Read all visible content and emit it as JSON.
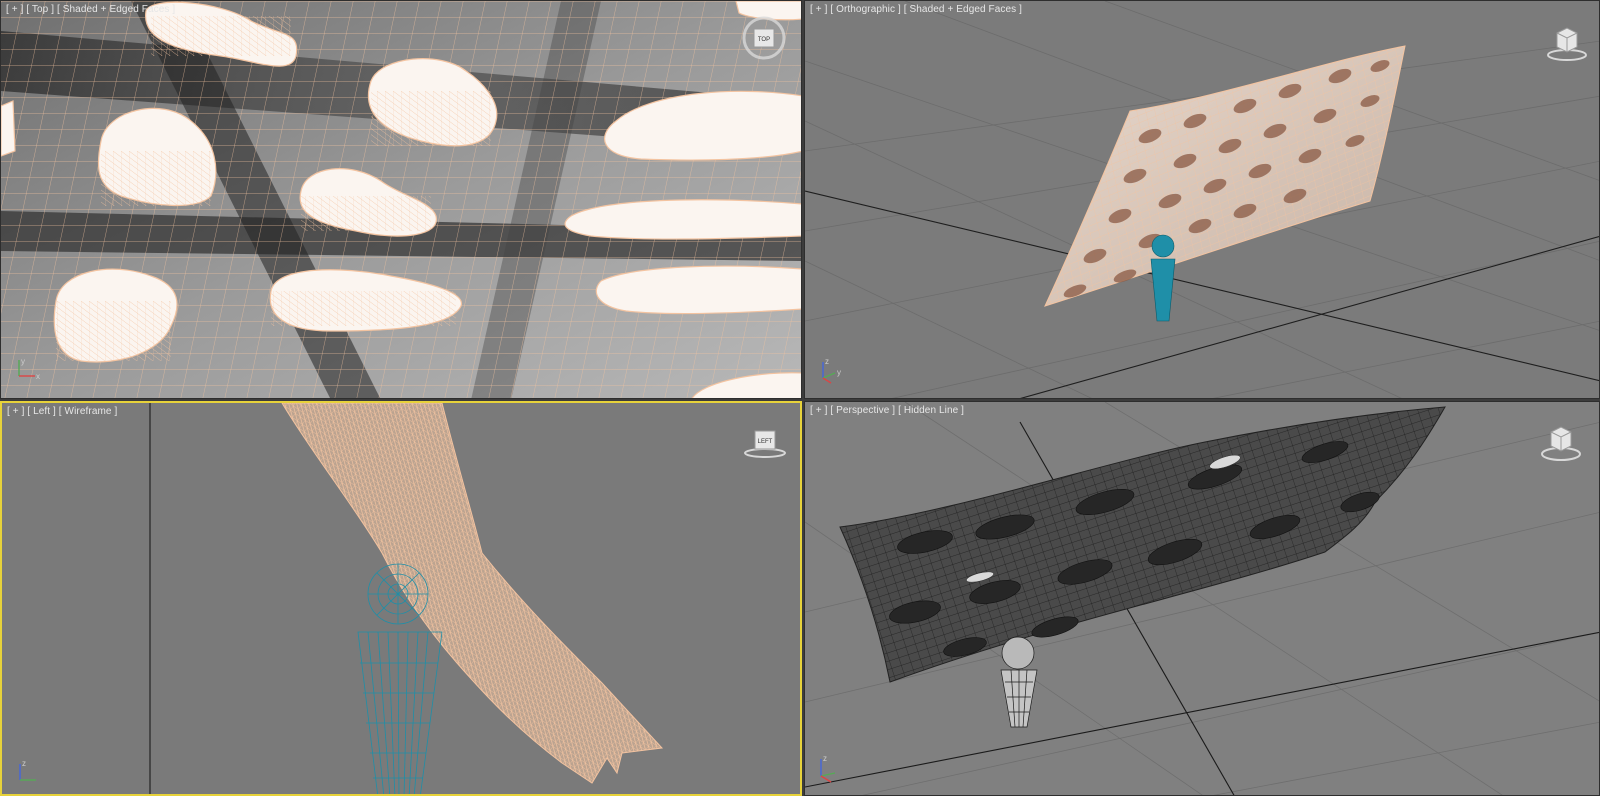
{
  "viewports": {
    "top": {
      "label": "[ + ] [ Top ] [ Shaded + Edged Faces ]",
      "navcube_label": "TOP"
    },
    "orthographic": {
      "label": "[ + ] [ Orthographic ] [ Shaded + Edged Faces ]"
    },
    "left": {
      "label": "[ + ] [ Left ] [ Wireframe ]",
      "navcube_label": "LEFT"
    },
    "perspective": {
      "label": "[ + ] [ Perspective ] [ Hidden Line ]"
    }
  },
  "axes": {
    "x": "x",
    "y": "y",
    "z": "z"
  },
  "colors": {
    "wire_peach": "#f3c3a0",
    "teal_object": "#1f8fa8",
    "active_border": "#e7d23a",
    "grid_dark": "#1a1a1a"
  }
}
